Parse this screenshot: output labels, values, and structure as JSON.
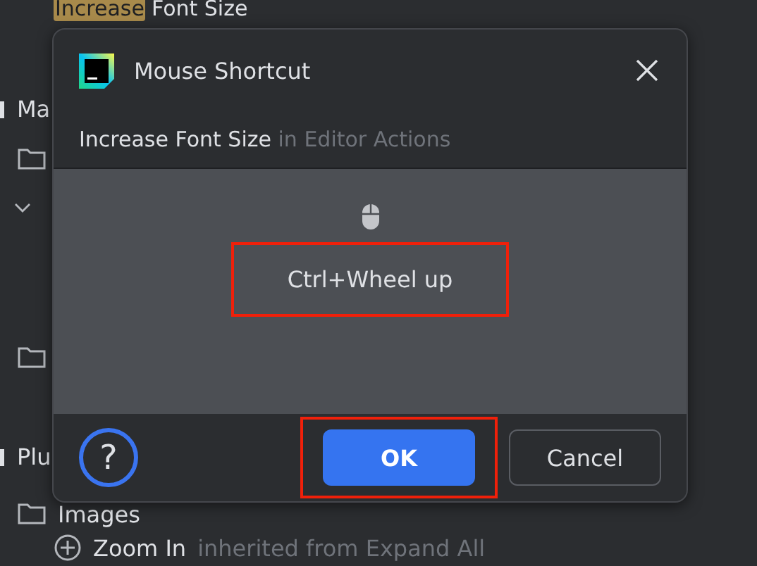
{
  "background": {
    "header": {
      "highlight": "Increase",
      "rest": "Font Size"
    },
    "rows": [
      {
        "kind": "group",
        "label": "Ma"
      },
      {
        "kind": "folder",
        "label": ""
      },
      {
        "kind": "chevron",
        "label": ""
      },
      {
        "kind": "spacer",
        "label": ""
      },
      {
        "kind": "spacer",
        "label": ""
      },
      {
        "kind": "folder",
        "label": ""
      },
      {
        "kind": "spacer",
        "label": ""
      },
      {
        "kind": "group",
        "label": "Plu"
      },
      {
        "kind": "folder",
        "label": "Images"
      },
      {
        "kind": "action",
        "label": "Zoom In",
        "note": "inherited from Expand All"
      }
    ]
  },
  "dialog": {
    "title": "Mouse Shortcut",
    "action": "Increase Font Size",
    "context": "in Editor Actions",
    "shortcut": "Ctrl+Wheel up",
    "buttons": [
      {
        "label": "OK",
        "primary": true
      },
      {
        "label": "Cancel",
        "primary": false
      }
    ],
    "help": "?"
  }
}
